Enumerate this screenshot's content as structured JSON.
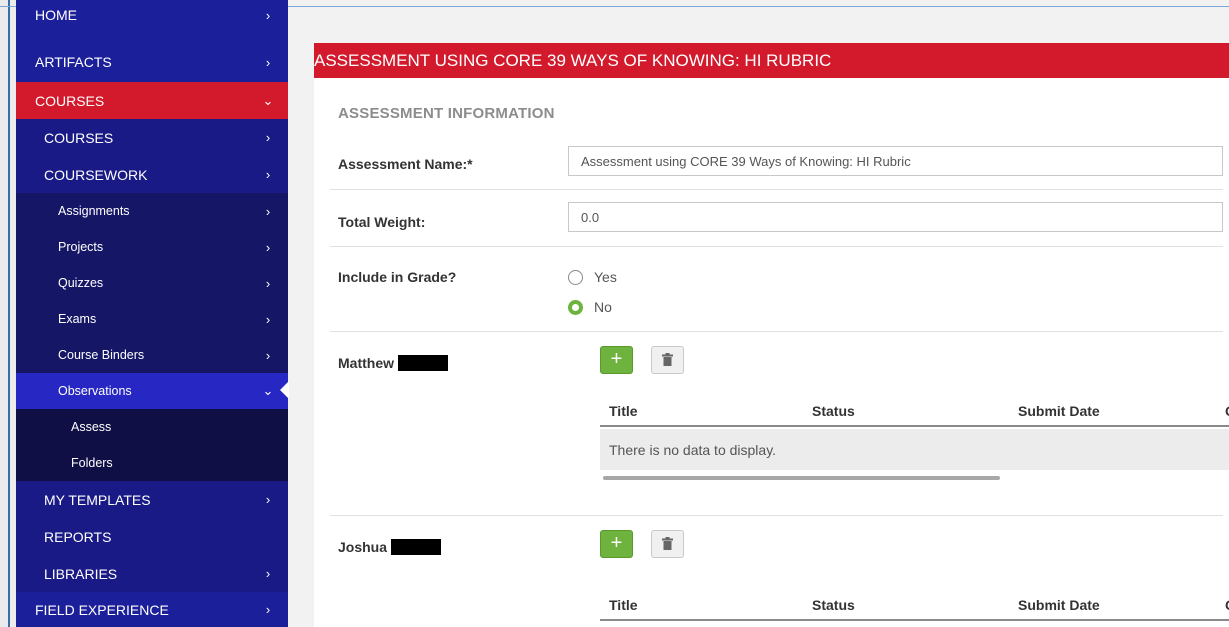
{
  "sidebar": {
    "items": [
      {
        "label": "HOME"
      },
      {
        "label": "ARTIFACTS"
      },
      {
        "label": "COURSES"
      },
      {
        "label": "COURSES"
      },
      {
        "label": "COURSEWORK"
      },
      {
        "label": "Assignments"
      },
      {
        "label": "Projects"
      },
      {
        "label": "Quizzes"
      },
      {
        "label": "Exams"
      },
      {
        "label": "Course Binders"
      },
      {
        "label": "Observations"
      },
      {
        "label": "Assess"
      },
      {
        "label": "Folders"
      },
      {
        "label": "MY TEMPLATES"
      },
      {
        "label": "REPORTS"
      },
      {
        "label": "LIBRARIES"
      },
      {
        "label": "FIELD EXPERIENCE"
      }
    ]
  },
  "main": {
    "title": "ASSESSMENT USING CORE 39 WAYS OF KNOWING: HI RUBRIC",
    "section_heading": "ASSESSMENT INFORMATION",
    "fields": {
      "assessment_name_label": "Assessment Name:*",
      "assessment_name_value": "Assessment using CORE 39 Ways of Knowing: HI Rubric",
      "total_weight_label": "Total Weight:",
      "total_weight_value": "0.0",
      "include_grade_label": "Include in Grade?",
      "option_yes": "Yes",
      "option_no": "No",
      "include_grade_selected": "No"
    },
    "students": [
      {
        "name": "Matthew"
      },
      {
        "name": "Joshua"
      }
    ],
    "grid": {
      "columns": [
        "Title",
        "Status",
        "Submit Date",
        "Gr"
      ],
      "empty_message": "There is no data to display."
    }
  },
  "colors": {
    "sidebar_bg": "#1c1f9a",
    "accent_red": "#d21a2c",
    "add_green": "#6fb33f"
  }
}
